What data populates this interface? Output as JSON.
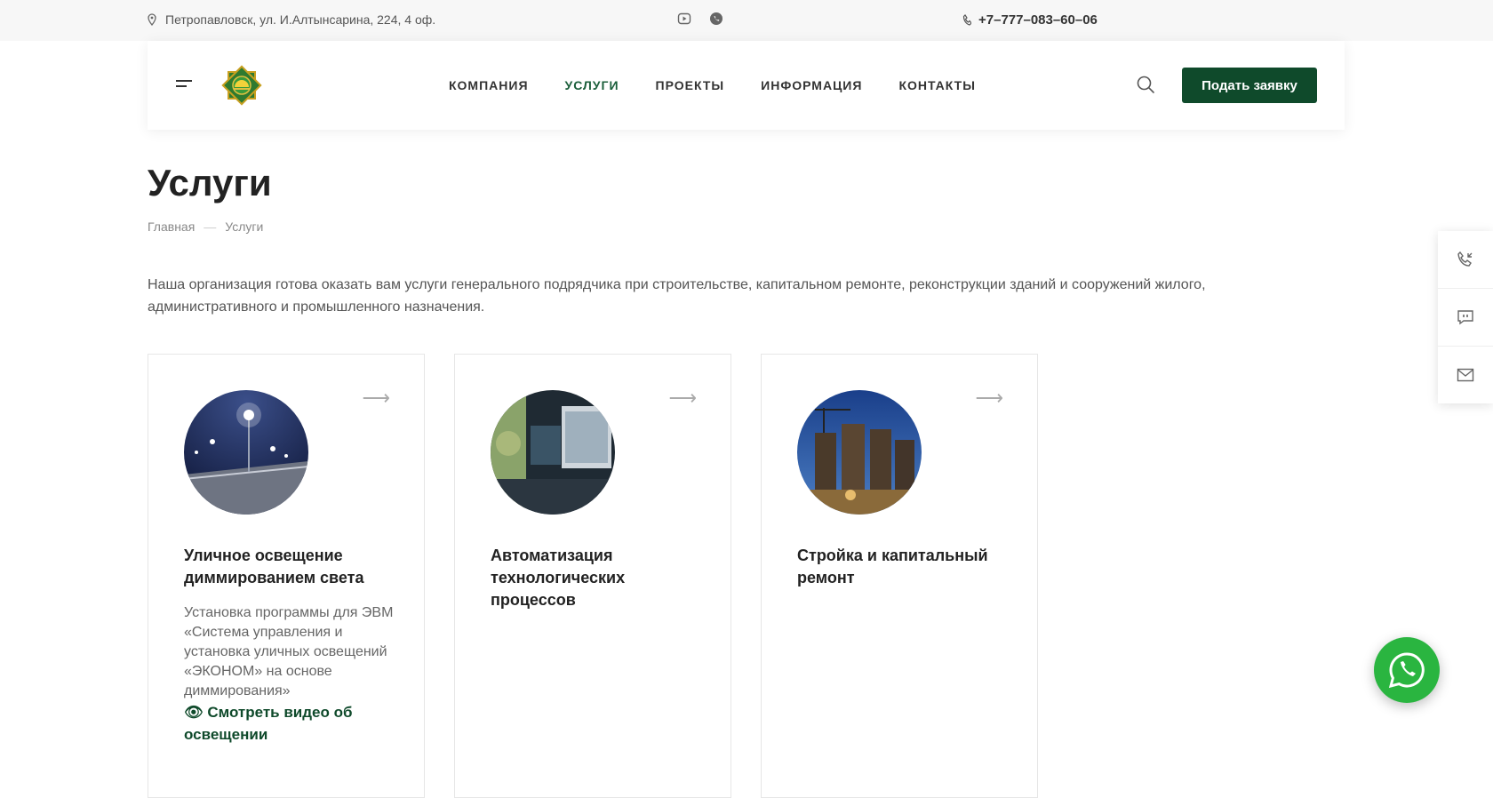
{
  "topbar": {
    "address": "Петропавловск, ул. И.Алтынсарина, 224, 4 оф.",
    "phone": "+7–777–083–60–06"
  },
  "nav": {
    "items": [
      "КОМПАНИЯ",
      "УСЛУГИ",
      "ПРОЕКТЫ",
      "ИНФОРМАЦИЯ",
      "КОНТАКТЫ"
    ],
    "active": "УСЛУГИ"
  },
  "cta_label": "Подать заявку",
  "page": {
    "title": "Услуги",
    "breadcrumb": [
      "Главная",
      "Услуги"
    ],
    "intro": "Наша организация готова оказать вам услуги генерального подрядчика при строительстве, капитальном ремонте, реконструкции зданий и сооружений жилого, административного и промышленного назначения."
  },
  "cards": [
    {
      "title": "Уличное освещение диммированием света",
      "description": "Установка программы для ЭВМ «Система управления и установка уличных освещений «ЭКОНОМ» на основе диммирования»",
      "video_link": "Смотреть видео об освещении",
      "image": "street-lights-photo"
    },
    {
      "title": "Автоматизация технологических процессов",
      "description": "",
      "video_link": "",
      "image": "control-room-photo"
    },
    {
      "title": "Стройка и капитальный ремонт",
      "description": "",
      "video_link": "",
      "image": "construction-site-photo"
    }
  ],
  "icons": {
    "address": "location-pin-icon",
    "youtube": "youtube-icon",
    "whatsapp": "whatsapp-icon",
    "phone": "phone-icon",
    "search": "search-icon",
    "arrow": "arrow-right-icon",
    "callback": "phone-callback-icon",
    "chat": "chat-icon",
    "mail": "mail-icon"
  },
  "colors": {
    "brand": "#0f4a2b",
    "active_nav": "#1a5e3a",
    "whatsapp": "#2ab540"
  }
}
